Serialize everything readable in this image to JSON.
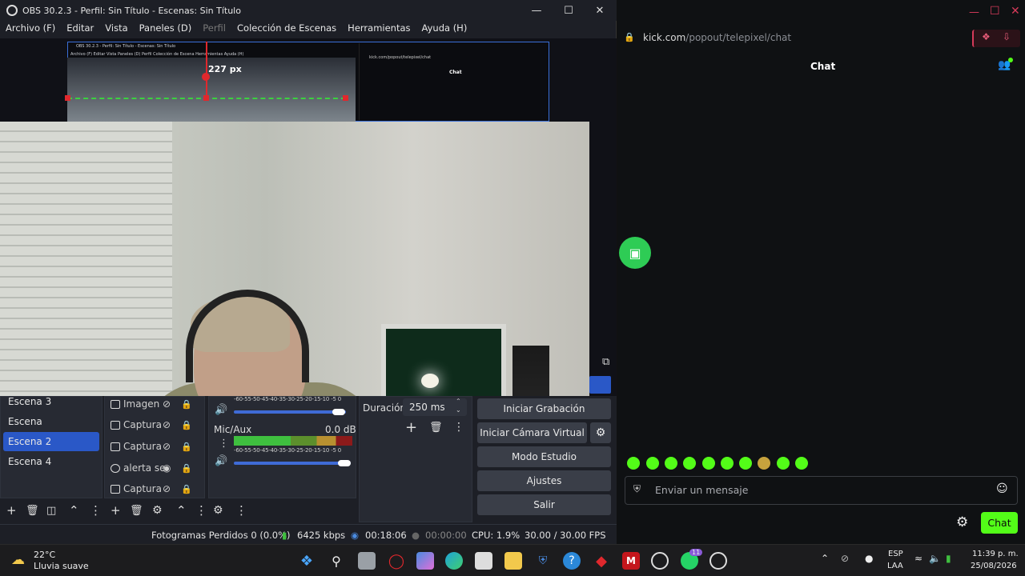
{
  "obs": {
    "title": "OBS 30.2.3 - Perfil: Sin Título - Escenas: Sin Título",
    "menu": [
      "Archivo (F)",
      "Editar",
      "Vista",
      "Paneles (D)",
      "Perfil",
      "Colección de Escenas",
      "Herramientas",
      "Ayuda (H)"
    ],
    "preview": {
      "mini_title": "OBS 30.2.3 - Perfil: Sin Título - Escenas: Sin Título",
      "mini_menu": "Archivo (F)   Editar   Vista   Paneles (D)   Perfil   Colección de Escena   Herramientas   Ayuda (H)",
      "mini_url": "kick.com/popout/telepixel/chat",
      "mini_chat": "Chat",
      "px_label": "227 px"
    },
    "scenes": [
      "Escena 3",
      "Escena",
      "Escena 2",
      "Escena 4"
    ],
    "selected_scene": "Escena 2",
    "sources": [
      {
        "label": "Imagen",
        "visible": false
      },
      {
        "label": "Captura",
        "visible": false
      },
      {
        "label": "Captura",
        "visible": false
      },
      {
        "label": "alerta se",
        "visible": true
      },
      {
        "label": "Captura",
        "visible": false
      }
    ],
    "mixer": {
      "scale": "-60-55-50-45-40-35-30-25-20-15-10 -5  0",
      "channel2_name": "Mic/Aux",
      "channel2_db": "0.0 dB"
    },
    "transition": {
      "label": "Duración",
      "value": "250 ms"
    },
    "controls": [
      "Iniciar Grabación",
      "Iniciar Cámara Virtual",
      "Modo Estudio",
      "Ajustes",
      "Salir"
    ],
    "status": {
      "dropped": "Fotogramas Perdidos 0 (0.0%)",
      "bitrate": "6425 kbps",
      "stream_time": "00:18:06",
      "rec_time": "00:00:00",
      "cpu": "CPU: 1.9%",
      "fps": "30.00 / 30.00 FPS"
    }
  },
  "chat": {
    "url_domain": "kick.com",
    "url_path": "/popout/telepixel/chat",
    "header": "Chat",
    "placeholder": "Enviar un mensaje",
    "send_label": "Chat",
    "accent": "#53fc18"
  },
  "taskbar": {
    "weather_temp": "22°C",
    "weather_desc": "Lluvia suave",
    "lang_top": "ESP",
    "lang_bottom": "LAA",
    "time": "11:39 p. m.",
    "date": "25/08/2026",
    "whatsapp_badge": "11"
  }
}
